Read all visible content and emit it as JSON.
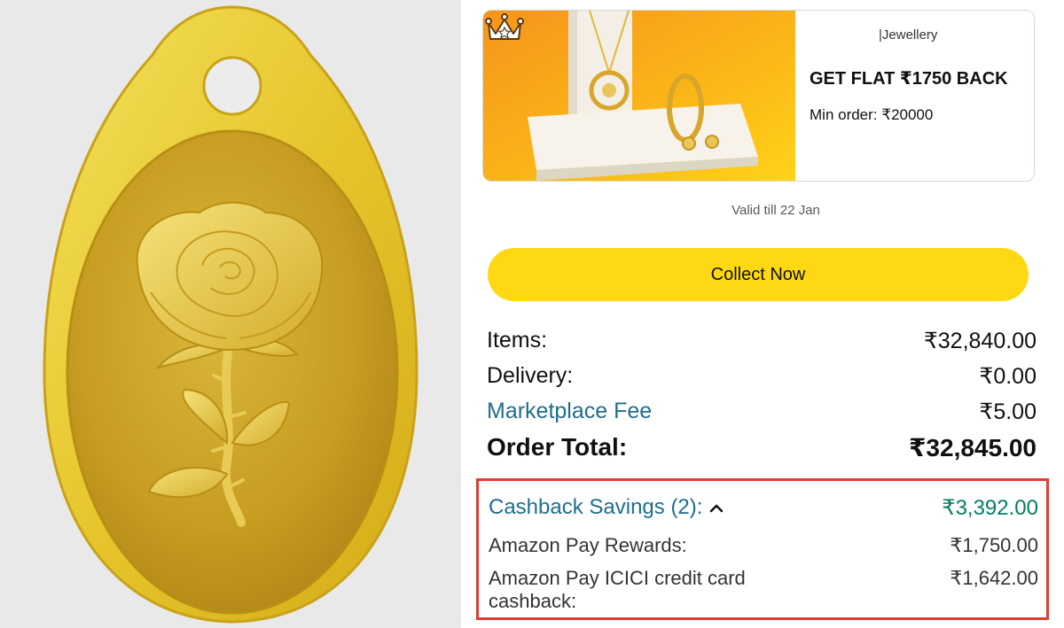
{
  "offer": {
    "category": "|Jewellery",
    "headline": "GET FLAT ₹1750 BACK",
    "min_order": "Min order: ₹20000",
    "icon": "crown-icon"
  },
  "valid_till": "Valid till 22 Jan",
  "collect_button": "Collect Now",
  "summary": {
    "items_label": "Items:",
    "items_value": "₹32,840.00",
    "delivery_label": "Delivery:",
    "delivery_value": "₹0.00",
    "fee_label": "Marketplace Fee",
    "fee_value": "₹5.00",
    "total_label": "Order Total:",
    "total_value": "₹32,845.00"
  },
  "cashback": {
    "heading": "Cashback Savings (2):",
    "heading_value": "₹3,392.00",
    "items": [
      {
        "label": "Amazon Pay Rewards:",
        "value": "₹1,750.00"
      },
      {
        "label": "Amazon Pay ICICI credit card",
        "label2": "cashback:",
        "value": "₹1,642.00"
      }
    ]
  },
  "colors": {
    "accent_yellow": "#ffd814",
    "link_blue": "#1f6e8c",
    "savings_green": "#067d62",
    "highlight_red": "#e03c31",
    "gold": "#d4b020"
  }
}
